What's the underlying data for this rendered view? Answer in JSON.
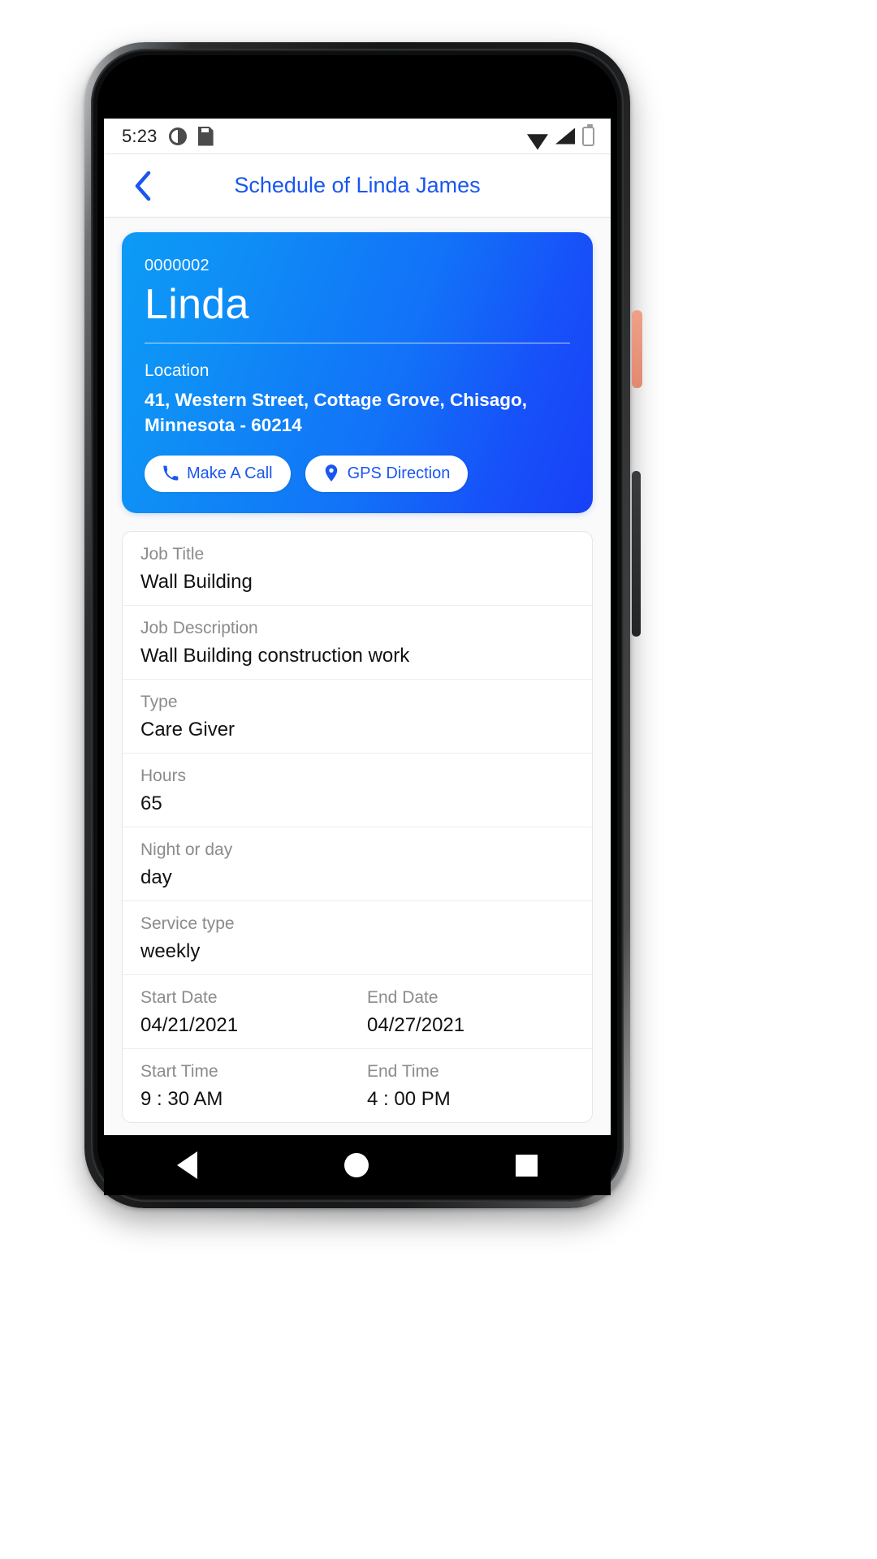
{
  "status_bar": {
    "time": "5:23",
    "icons_left": [
      "do-not-disturb-icon",
      "sd-card-icon"
    ],
    "icons_right": [
      "wifi-icon",
      "signal-icon",
      "battery-icon"
    ]
  },
  "app_bar": {
    "back_label": "‹",
    "title": "Schedule of Linda James",
    "title_color": "#1a56ef"
  },
  "hero": {
    "id": "0000002",
    "name": "Linda",
    "location_label": "Location",
    "address": "41, Western Street, Cottage Grove, Chisago, Minnesota - 60214",
    "gradient_from": "#0c9bf5",
    "gradient_to": "#1840f7",
    "actions": [
      {
        "label": "Make A Call",
        "icon": "phone-icon"
      },
      {
        "label": "GPS Direction",
        "icon": "map-pin-icon"
      }
    ]
  },
  "details": {
    "rows": [
      {
        "label": "Job Title",
        "value": "Wall Building"
      },
      {
        "label": "Job Description",
        "value": "Wall Building construction work"
      },
      {
        "label": "Type",
        "value": "Care Giver"
      },
      {
        "label": "Hours",
        "value": "65"
      },
      {
        "label": "Night or day",
        "value": "day"
      },
      {
        "label": "Service type",
        "value": "weekly"
      }
    ],
    "split_rows": [
      {
        "label_1": "Start Date",
        "value_1": "04/21/2021",
        "label_2": "End Date",
        "value_2": "04/27/2021"
      },
      {
        "label_1": "Start Time",
        "value_1": "9 : 30 AM",
        "label_2": "End Time",
        "value_2": "4 : 00 PM"
      }
    ]
  },
  "nav_bar": {
    "items": [
      "back-triangle-icon",
      "home-circle-icon",
      "recents-square-icon"
    ]
  }
}
